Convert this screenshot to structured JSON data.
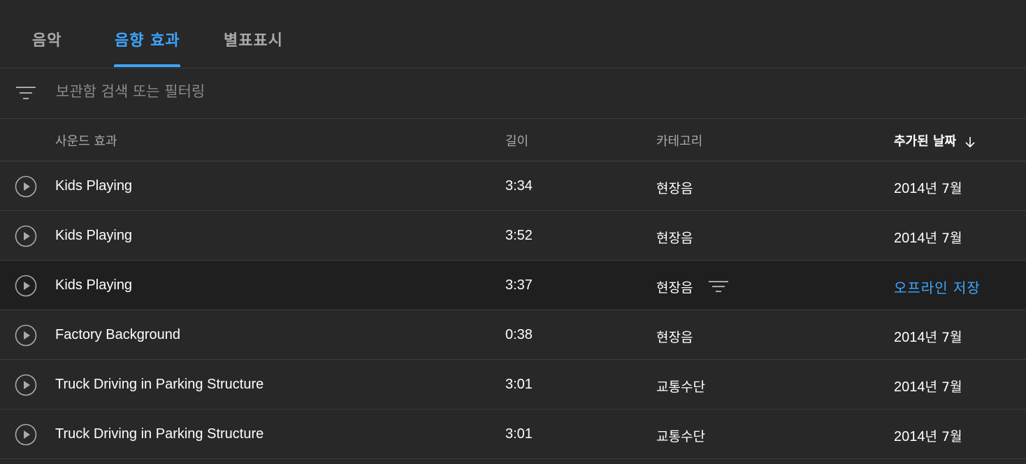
{
  "tabs": [
    {
      "label": "음악",
      "active": false
    },
    {
      "label": "음향 효과",
      "active": true
    },
    {
      "label": "별표표시",
      "active": false
    }
  ],
  "filter": {
    "placeholder": "보관함 검색 또는 필터링",
    "icon": "filter-icon"
  },
  "columns": {
    "title": "사운드 효과",
    "length": "길이",
    "category": "카테고리",
    "date_added": "추가된 날짜",
    "sort_direction": "descending"
  },
  "rows": [
    {
      "title": "Kids Playing",
      "length": "3:34",
      "category": "현장음",
      "date_num": "2014",
      "date_suffix": "년 7월"
    },
    {
      "title": "Kids Playing",
      "length": "3:52",
      "category": "현장음",
      "date_num": "2014",
      "date_suffix": "년 7월"
    },
    {
      "title": "Kids Playing",
      "length": "3:37",
      "category": "현장음",
      "offline_label": "오프라인 저장",
      "hovered": true
    },
    {
      "title": "Factory Background",
      "length": "0:38",
      "category": "현장음",
      "date_num": "2014",
      "date_suffix": "년 7월"
    },
    {
      "title": "Truck Driving in Parking Structure",
      "length": "3:01",
      "category": "교통수단",
      "date_num": "2014",
      "date_suffix": "년 7월"
    },
    {
      "title": "Truck Driving in Parking Structure",
      "length": "3:01",
      "category": "교통수단",
      "date_num": "2014",
      "date_suffix": "년 7월"
    }
  ],
  "colors": {
    "background": "#282828",
    "accent": "#3ea6ff",
    "divider": "#3d3d3d",
    "muted_text": "#aaaaaa",
    "hover_row": "#1f1f1f"
  }
}
